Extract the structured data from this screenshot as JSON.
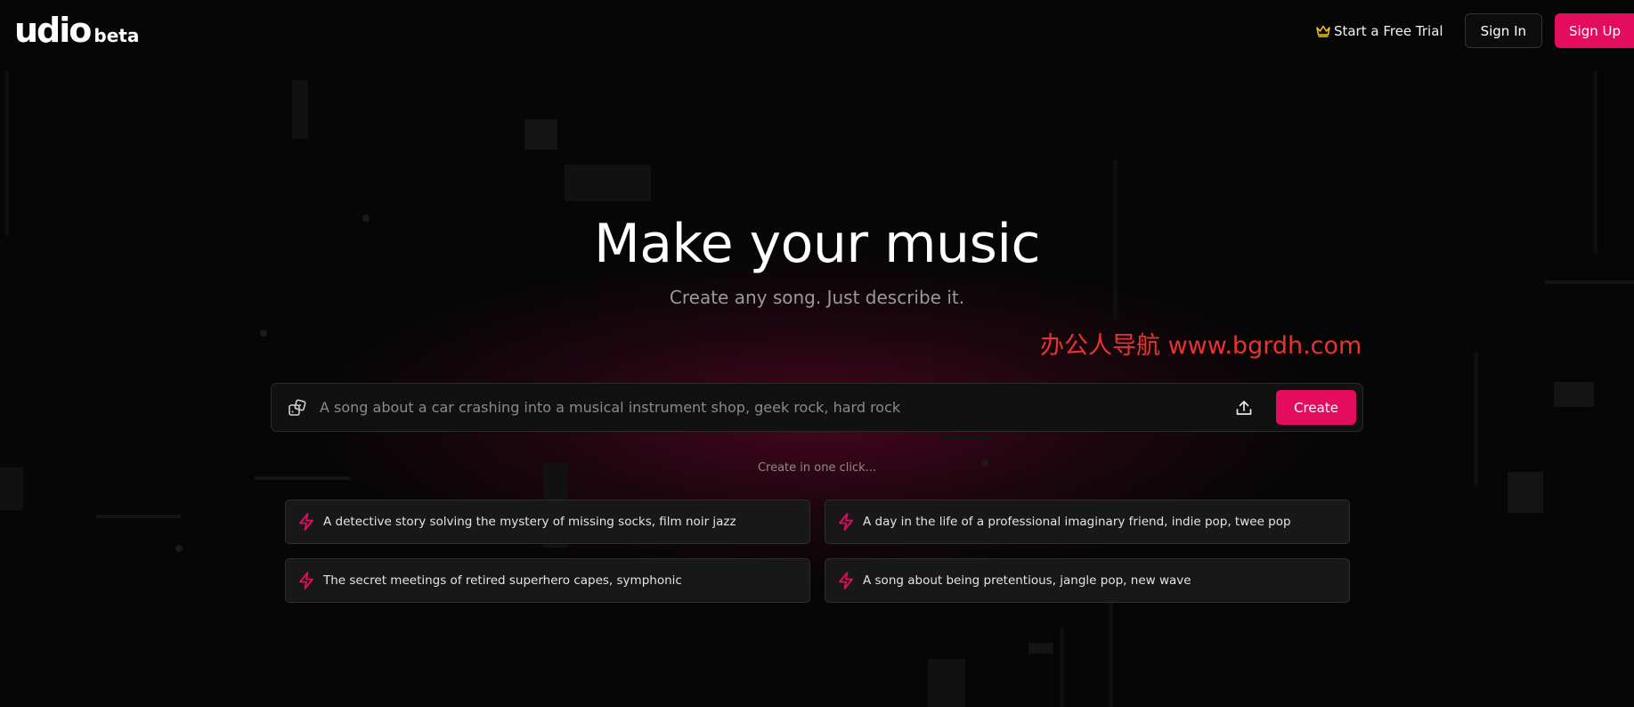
{
  "app": {
    "logo_text": "udio",
    "logo_badge": "beta"
  },
  "header": {
    "trial_label": "Start a Free Trial",
    "signin_label": "Sign In",
    "signup_label": "Sign Up"
  },
  "hero": {
    "title": "Make your music",
    "subtitle": "Create any song. Just describe it."
  },
  "watermark": "办公人导航 www.bgrdh.com",
  "prompt": {
    "placeholder": "A song about a car crashing into a musical instrument shop, geek rock, hard rock",
    "value": "",
    "create_label": "Create"
  },
  "one_click_label": "Create in one click...",
  "suggestions": [
    {
      "text": "A detective story solving the mystery of missing socks, film noir jazz"
    },
    {
      "text": "A day in the life of a professional imaginary friend, indie pop, twee pop"
    },
    {
      "text": "The secret meetings of retired superhero capes, symphonic"
    },
    {
      "text": "A song about being pretentious, jangle pop, new wave"
    }
  ],
  "icons": {
    "trial": "crown-icon",
    "random": "dice-icon",
    "upload": "upload-icon",
    "suggestion": "bolt-icon"
  },
  "colors": {
    "accent": "#e30c5d",
    "crown": "#f5c518",
    "background": "#060606",
    "watermark": "#e8332f"
  }
}
